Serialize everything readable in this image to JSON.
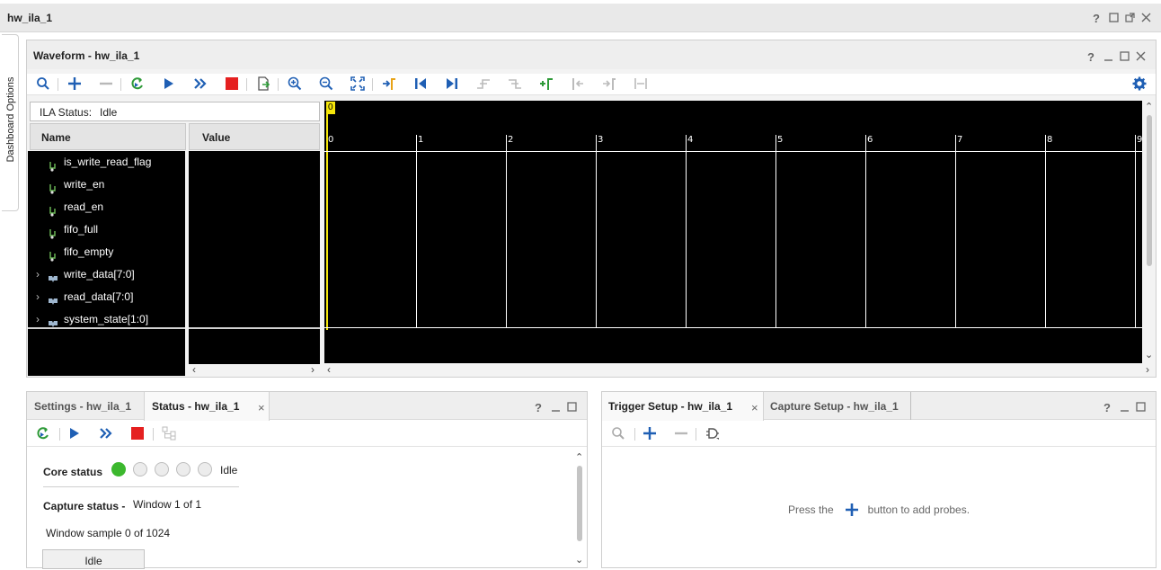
{
  "window": {
    "title": "hw_ila_1"
  },
  "side_tab": {
    "label": "Dashboard Options"
  },
  "waveform": {
    "title": "Waveform - hw_ila_1",
    "status_label": "ILA Status:",
    "status_value": "Idle",
    "col_name": "Name",
    "col_value": "Value",
    "marker_label": "0",
    "signals": [
      {
        "name": "is_write_read_flag",
        "kind": "bit"
      },
      {
        "name": "write_en",
        "kind": "bit"
      },
      {
        "name": "read_en",
        "kind": "bit"
      },
      {
        "name": "fifo_full",
        "kind": "bit"
      },
      {
        "name": "fifo_empty",
        "kind": "bit"
      },
      {
        "name": "write_data[7:0]",
        "kind": "bus"
      },
      {
        "name": "read_data[7:0]",
        "kind": "bus"
      },
      {
        "name": "system_state[1:0]",
        "kind": "bus"
      }
    ],
    "timeline_ticks": [
      "0",
      "1",
      "2",
      "3",
      "4",
      "5",
      "6",
      "7",
      "8",
      "9"
    ]
  },
  "status_panel": {
    "tab_settings": "Settings - hw_ila_1",
    "tab_status": "Status - hw_ila_1",
    "core_status_label": "Core status",
    "core_status_value": "Idle",
    "capture_status_label": "Capture status -",
    "capture_status_value": "Window 1 of 1",
    "window_sample": "Window sample 0 of 1024",
    "idle_button": "Idle",
    "colors": {
      "led_active": "#3cb82e",
      "led_inactive": "#ececec"
    }
  },
  "trigger_panel": {
    "tab_trigger": "Trigger Setup - hw_ila_1",
    "tab_capture": "Capture Setup - hw_ila_1",
    "hint_before": "Press the",
    "hint_after": "button to add probes."
  },
  "colors": {
    "accent_blue": "#1f5fb4",
    "stop_red": "#e52020",
    "green": "#2e9a38",
    "marker_yellow": "#f5e60a",
    "wave_bg": "#000000"
  }
}
